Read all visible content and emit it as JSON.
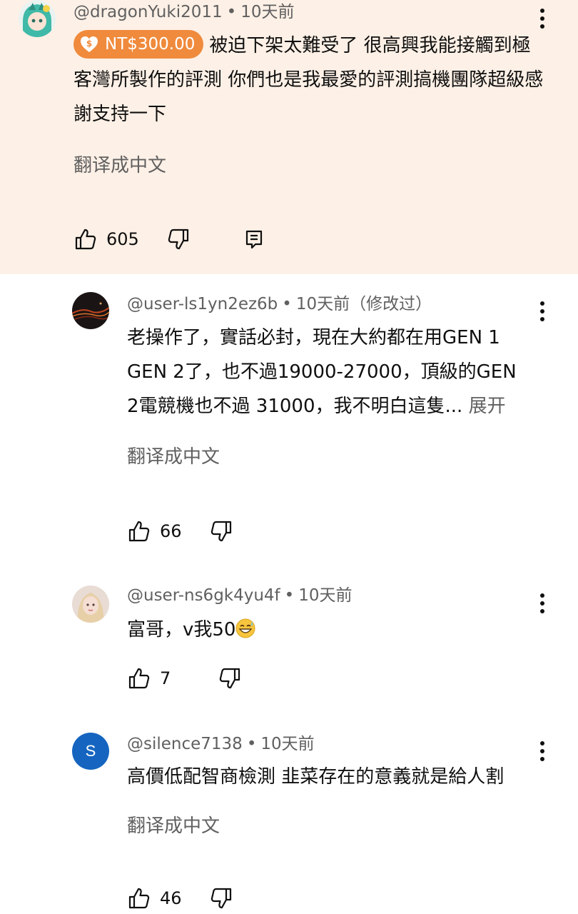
{
  "comments": [
    {
      "author": "@dragonYuki2011",
      "time": "10天前",
      "super_amount": "NT$300.00",
      "text": "被迫下架太難受了 很高興我能接觸到極客灣所製作的評測 你們也是我最愛的評測搞機團隊超級感謝支持一下",
      "translate": "翻译成中文",
      "likes": "605"
    },
    {
      "author": "@user-ls1yn2ez6b",
      "time": "10天前",
      "edited": "（修改过）",
      "text": "老操作了，實話必封，現在大約都在用GEN 1 GEN 2了，也不過19000-27000，頂級的GEN 2電競機也不過 31000，我不明白這隻...",
      "expand": "展开",
      "translate": "翻译成中文",
      "likes": "66"
    },
    {
      "author": "@user-ns6gk4yu4f",
      "time": "10天前",
      "text": "富哥，v我50",
      "likes": "7"
    },
    {
      "author": "@silence7138",
      "avatar_letter": "S",
      "time": "10天前",
      "text": "高價低配智商檢測 韭菜存在的意義就是給人割",
      "translate": "翻译成中文",
      "likes": "46"
    }
  ],
  "colors": {
    "pinned_bg": "#fdf0e6",
    "super_chip": "#f08a3c",
    "avatar_s": "#1565c0"
  },
  "icons": [
    "like-icon",
    "dislike-icon",
    "reply-icon",
    "more-vert-icon",
    "super-thanks-icon",
    "grin-sweat-emoji"
  ]
}
